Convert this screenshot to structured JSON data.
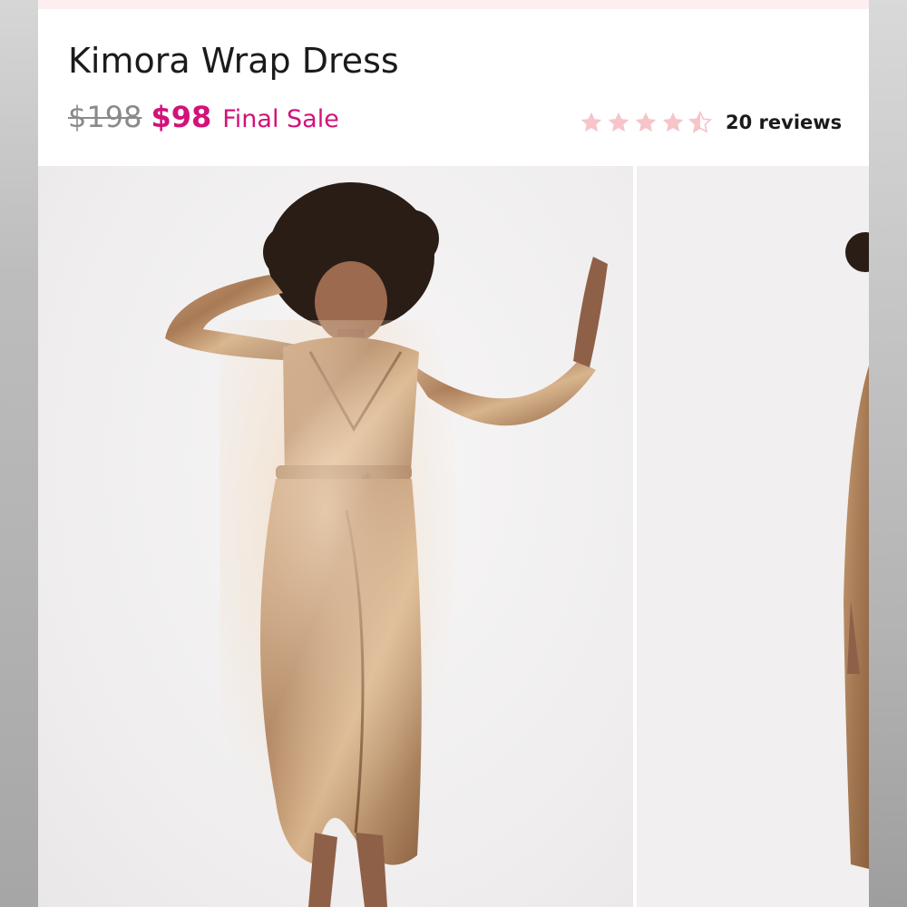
{
  "product": {
    "title": "Kimora Wrap Dress",
    "price_original": "$198",
    "price_sale": "$98",
    "sale_note": "Final Sale",
    "rating": 4.5,
    "rating_max": 5,
    "reviews_label": "20 reviews"
  },
  "colors": {
    "sale_pink": "#d2127a",
    "star_pink": "#f6c4c9",
    "strike_gray": "#8a8a8a"
  },
  "icons": {
    "star": "star-icon",
    "half_star": "star-half-icon"
  },
  "gallery": {
    "images": [
      "product-photo-1",
      "product-photo-2"
    ]
  }
}
